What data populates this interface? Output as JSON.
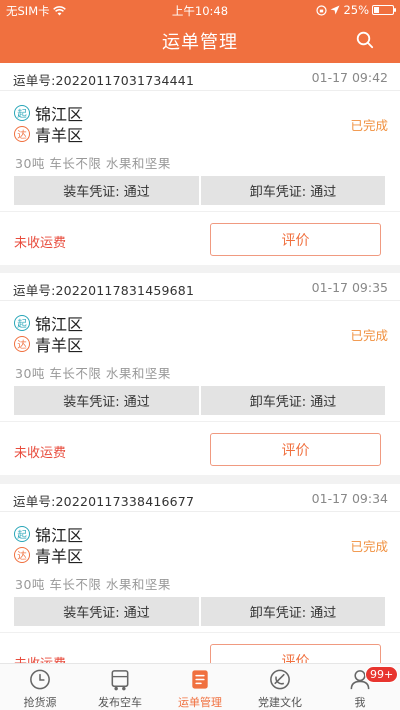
{
  "status_bar": {
    "carrier": "无SIM卡",
    "time": "上午10:48",
    "battery": "25%",
    "battery_level": 0.25
  },
  "header": {
    "title": "运单管理",
    "search_icon": "search-icon"
  },
  "orders": [
    {
      "waybill_label": "运单号:20220117031734441",
      "time": "01-17 09:42",
      "origin_badge": "起",
      "origin": "锦江区",
      "dest_badge": "达",
      "destination": "青羊区",
      "status": "已完成",
      "cargo": "30吨 车长不限 水果和坚果",
      "load_cert": "装车凭证: 通过",
      "unload_cert": "卸车凭证: 通过",
      "fee_status": "未收运费",
      "rate_label": "评价"
    },
    {
      "waybill_label": "运单号:20220117831459681",
      "time": "01-17 09:35",
      "origin_badge": "起",
      "origin": "锦江区",
      "dest_badge": "达",
      "destination": "青羊区",
      "status": "已完成",
      "cargo": "30吨 车长不限 水果和坚果",
      "load_cert": "装车凭证: 通过",
      "unload_cert": "卸车凭证: 通过",
      "fee_status": "未收运费",
      "rate_label": "评价"
    },
    {
      "waybill_label": "运单号:20220117338416677",
      "time": "01-17 09:34",
      "origin_badge": "起",
      "origin": "锦江区",
      "dest_badge": "达",
      "destination": "青羊区",
      "status": "已完成",
      "cargo": "30吨 车长不限 水果和坚果",
      "load_cert": "装车凭证: 通过",
      "unload_cert": "卸车凭证: 通过",
      "fee_status": "未收运费",
      "rate_label": "评价"
    }
  ],
  "tabbar": {
    "tabs": [
      {
        "label": "抢货源",
        "icon": "clock-icon"
      },
      {
        "label": "发布空车",
        "icon": "truck-icon"
      },
      {
        "label": "运单管理",
        "icon": "waybill-icon",
        "active": true
      },
      {
        "label": "党建文化",
        "icon": "party-emblem-icon"
      },
      {
        "label": "我",
        "icon": "profile-icon",
        "badge": "99+"
      }
    ]
  },
  "colors": {
    "brand": "#f0703f",
    "status_done": "#f0903f",
    "fee_unpaid": "#e84c3d",
    "badge_start": "#2aa6b8"
  }
}
